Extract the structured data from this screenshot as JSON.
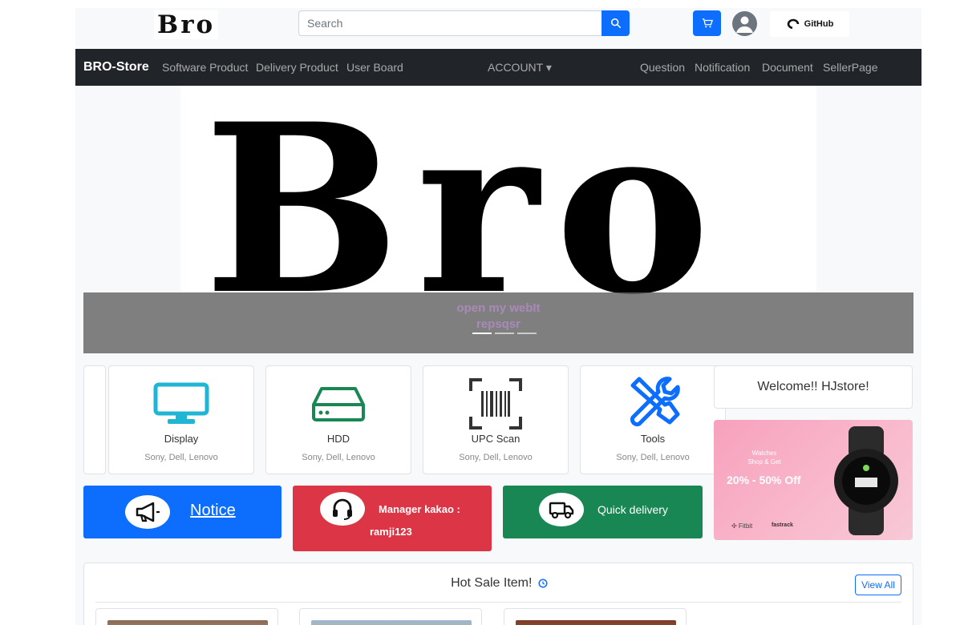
{
  "header": {
    "logo": "Bro",
    "search_placeholder": "Search",
    "github_label": "GitHub"
  },
  "nav": {
    "brand": "BRO-Store",
    "left_links": [
      "Software Product",
      "Delivery Product",
      "User Board"
    ],
    "account_label": "ACCOUNT ▾",
    "right_links": [
      "Question",
      "Notification",
      "Document",
      "SellerPage"
    ]
  },
  "hero": {
    "big_text": "Bro",
    "caption_line1": "open my webIt",
    "caption_line2": "repsqsr",
    "indicator_count": 3,
    "active_indicator": 0
  },
  "categories": [
    {
      "title": "Display",
      "brands": "Sony, Dell, Lenovo",
      "icon": "monitor-icon"
    },
    {
      "title": "HDD",
      "brands": "Sony, Dell, Lenovo",
      "icon": "hdd-icon"
    },
    {
      "title": "UPC Scan",
      "brands": "Sony, Dell, Lenovo",
      "icon": "barcode-scan-icon"
    },
    {
      "title": "Tools",
      "brands": "Sony, Dell, Lenovo",
      "icon": "tools-icon"
    }
  ],
  "welcome": {
    "text": "Welcome!! HJstore!"
  },
  "promo": {
    "small_line1": "Watches",
    "small_line2": "Shop & Get",
    "discount": "20% - 50% Off",
    "brand1": "✣ Fitbit",
    "brand2": "fastrack"
  },
  "actions": {
    "notice_label": "Notice",
    "manager_line1": "Manager kakao :",
    "manager_line2": "ramji123",
    "delivery_label": "Quick delivery"
  },
  "hot_sale": {
    "title": "Hot Sale Item!",
    "view_all": "View All"
  },
  "colors": {
    "primary": "#0d6efd",
    "danger": "#dc3545",
    "success": "#198754",
    "dark": "#212529",
    "display_icon": "#1fb6d6",
    "hdd_icon": "#198754",
    "tools_icon": "#0d6efd"
  }
}
